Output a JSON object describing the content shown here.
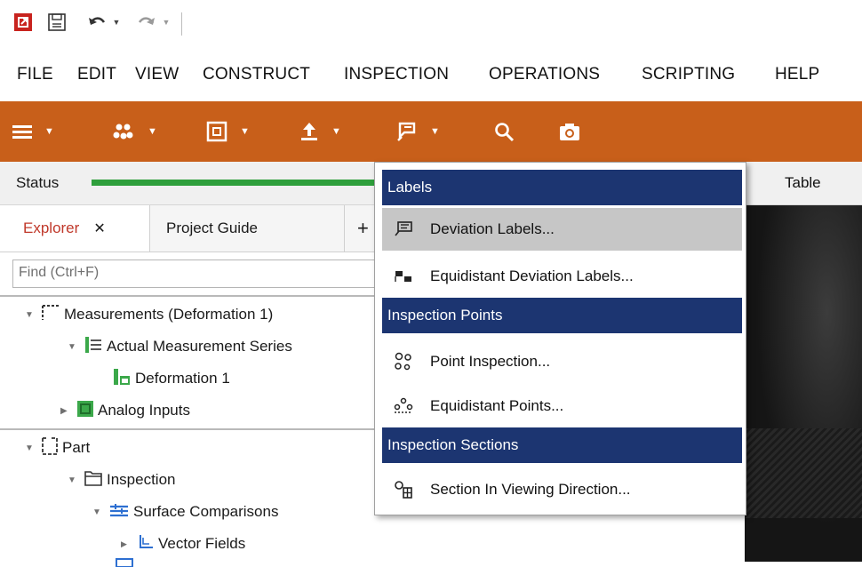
{
  "menu": {
    "items": [
      "FILE",
      "EDIT",
      "VIEW",
      "CONSTRUCT",
      "INSPECTION",
      "OPERATIONS",
      "SCRIPTING",
      "HELP"
    ]
  },
  "left_panel": {
    "status_label": "Status",
    "tabs": {
      "explorer": "Explorer",
      "close": "✕",
      "project_guide": "Project Guide",
      "add": "+"
    },
    "find_placeholder": "Find (Ctrl+F)",
    "tree": [
      {
        "label": "Measurements (Deformation 1)"
      },
      {
        "label": "Actual Measurement Series"
      },
      {
        "label": "Deformation 1"
      },
      {
        "label": "Analog Inputs"
      },
      {
        "label": "Part"
      },
      {
        "label": "Inspection"
      },
      {
        "label": "Surface Comparisons"
      },
      {
        "label": "Vector Fields"
      }
    ]
  },
  "viewport": {
    "table_label": "Table"
  },
  "dropdown": {
    "sections": [
      {
        "title": "Labels",
        "items": [
          {
            "label": "Deviation Labels...",
            "icon": "deviation-label-icon",
            "highlighted": true
          },
          {
            "label": "Equidistant Deviation Labels...",
            "icon": "equidistant-label-icon",
            "highlighted": false
          }
        ]
      },
      {
        "title": "Inspection Points",
        "items": [
          {
            "label": "Point Inspection...",
            "icon": "point-inspection-icon"
          },
          {
            "label": "Equidistant Points...",
            "icon": "equidistant-points-icon"
          }
        ]
      },
      {
        "title": "Inspection Sections",
        "items": [
          {
            "label": "Section In Viewing Direction...",
            "icon": "section-icon"
          }
        ]
      }
    ]
  },
  "colors": {
    "toolbar": "#c85f1a",
    "section_header": "#1c3571",
    "highlight": "#c6c6c6",
    "status_bar": "#2f9f3c",
    "explorer_tab": "#c0392b"
  }
}
